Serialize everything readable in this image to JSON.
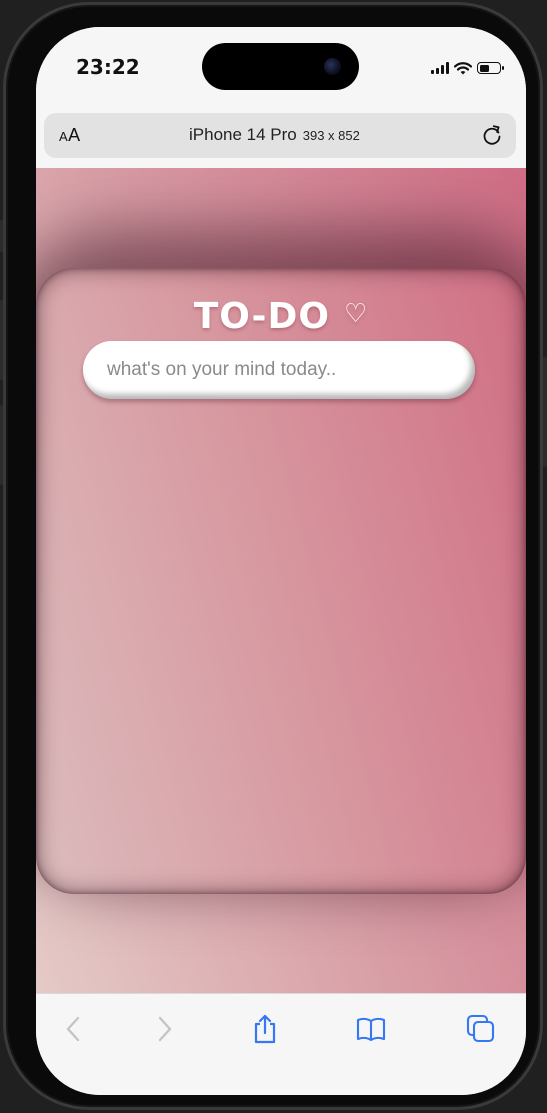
{
  "status_bar": {
    "time": "23:22"
  },
  "address_bar": {
    "text_size_small": "A",
    "text_size_big": "A",
    "device_name": "iPhone 14 Pro",
    "device_size": "393 x 852",
    "reload_icon": "reload-icon"
  },
  "page": {
    "title": "TO-DO",
    "heart": "♡",
    "input_placeholder": "what's on your mind today..",
    "input_value": ""
  },
  "toolbar": {
    "items": [
      "back-icon",
      "forward-icon",
      "share-icon",
      "bookmarks-icon",
      "tabs-icon"
    ]
  },
  "colors": {
    "accent": "#3478f6",
    "disabled": "#c4c4c6",
    "gradient_start": "#e4cac7",
    "gradient_end": "#cf6d85"
  }
}
